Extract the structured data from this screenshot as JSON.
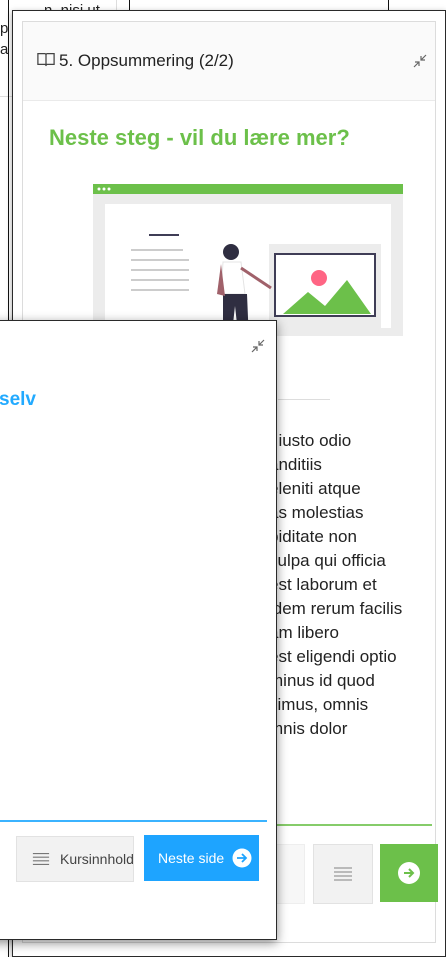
{
  "background": {
    "partial_text_lines": [
      "n, nisi ut",
      "p",
      "a"
    ]
  },
  "back_card": {
    "header": {
      "title": "5. Oppsummering (2/2)",
      "book_icon": "book-open-icon",
      "collapse_icon": "collapse-icon"
    },
    "heading": "Neste steg - vil du lære mer?",
    "illustration": "presentation-illustration",
    "paragraph": "t iusto odio\nanditiis\neleniti atque\nas molestias\npiditate non\n culpa qui officia\nest laborum et\nidem rerum facilis\nam libero\nest eligendi optio\nminus id quod\nsimus, omnis\nmnis dolor",
    "buttons": {
      "toc_icon": "list-icon",
      "next_icon": "arrow-right-circle-icon"
    },
    "colors": {
      "accent": "#6cc04a"
    }
  },
  "front_card": {
    "heading_partial": "selv",
    "collapse_icon": "collapse-icon",
    "toc_button": {
      "label": "Kursinnhold",
      "icon": "list-icon"
    },
    "next_button": {
      "label": "Neste side",
      "icon": "arrow-right-circle-icon"
    },
    "colors": {
      "accent": "#22aaff"
    }
  }
}
